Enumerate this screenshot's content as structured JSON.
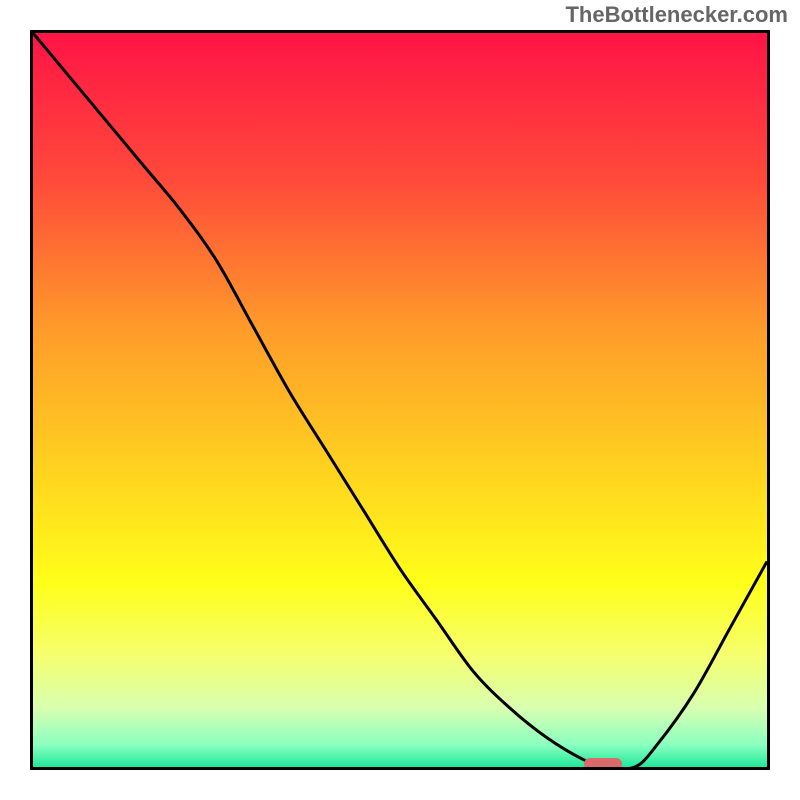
{
  "watermark": "TheBottlenecker.com",
  "chart_data": {
    "type": "line",
    "title": "",
    "xlabel": "",
    "ylabel": "",
    "xlim": [
      0,
      100
    ],
    "ylim": [
      0,
      100
    ],
    "x": [
      0,
      5,
      10,
      15,
      20,
      25,
      30,
      35,
      40,
      45,
      50,
      55,
      60,
      65,
      70,
      75,
      78,
      82,
      85,
      90,
      95,
      100
    ],
    "values": [
      100,
      94,
      88,
      82,
      76,
      69,
      60,
      51,
      43,
      35,
      27,
      20,
      13,
      8,
      4,
      1,
      0,
      0,
      3,
      10,
      19,
      28
    ],
    "gradient_stops": [
      {
        "pos": 0.0,
        "color": "#ff1446"
      },
      {
        "pos": 0.2,
        "color": "#ff4a3a"
      },
      {
        "pos": 0.4,
        "color": "#ff9a2a"
      },
      {
        "pos": 0.6,
        "color": "#ffd41f"
      },
      {
        "pos": 0.75,
        "color": "#ffff1a"
      },
      {
        "pos": 0.85,
        "color": "#f5ff70"
      },
      {
        "pos": 0.92,
        "color": "#d8ffb0"
      },
      {
        "pos": 0.97,
        "color": "#8affc0"
      },
      {
        "pos": 1.0,
        "color": "#20e89a"
      }
    ],
    "marker": {
      "x_pct": 77,
      "y_pct": 98.8
    }
  }
}
